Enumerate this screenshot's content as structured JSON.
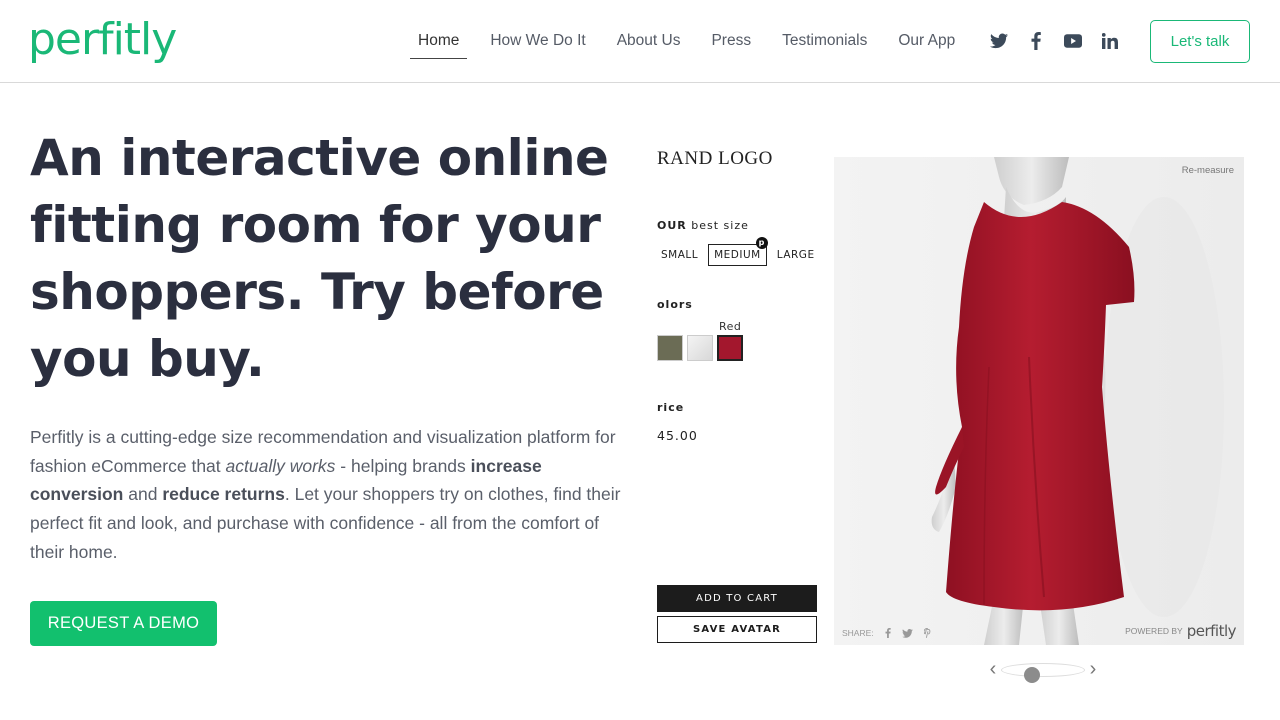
{
  "header": {
    "logo_text": "perfitly",
    "nav": [
      {
        "label": "Home",
        "active": true
      },
      {
        "label": "How We Do It",
        "active": false
      },
      {
        "label": "About Us",
        "active": false
      },
      {
        "label": "Press",
        "active": false
      },
      {
        "label": "Testimonials",
        "active": false
      },
      {
        "label": "Our App",
        "active": false
      }
    ],
    "socials": [
      "twitter-icon",
      "facebook-icon",
      "youtube-icon",
      "linkedin-icon"
    ],
    "cta_label": "Let's talk"
  },
  "hero": {
    "headline": "An interactive online fitting room for your shoppers. Try before you buy.",
    "desc_1": "Perfitly is a cutting-edge size recommendation and visualization platform for fashion eCommerce that ",
    "desc_em": "actually works",
    "desc_2": " - helping brands ",
    "desc_b1": "increase conversion",
    "desc_3": " and ",
    "desc_b2": "reduce returns",
    "desc_4": ". Let your shoppers try on clothes, find their perfect fit and look, and purchase with confidence - all from the comfort of their home.",
    "demo_label": "REQUEST A DEMO"
  },
  "widget": {
    "brand_logo": "RAND LOGO",
    "best_size_prefix": "OUR",
    "best_size_label": "best size",
    "sizes": [
      "SMALL",
      "MEDIUM",
      "LARGE"
    ],
    "selected_size": "MEDIUM",
    "size_badge": "p",
    "colors_label": "olors",
    "selected_color_name": "Red",
    "swatch_colors": [
      "#6b6c55",
      "#e8e8e8",
      "#a3172d"
    ],
    "price_label": "rice",
    "price_value": "45.00",
    "add_to_cart": "ADD TO CART",
    "save_avatar": "SAVE  AVATAR",
    "remeasure": "Re-measure",
    "share_label": "SHARE:",
    "powered_by": "POWERED BY",
    "powered_logo": "perfitly",
    "dress_color": "#a8182c"
  },
  "colors": {
    "brand_green": "#1ab877",
    "demo_green": "#12c06e",
    "headline": "#2b2f3f"
  }
}
